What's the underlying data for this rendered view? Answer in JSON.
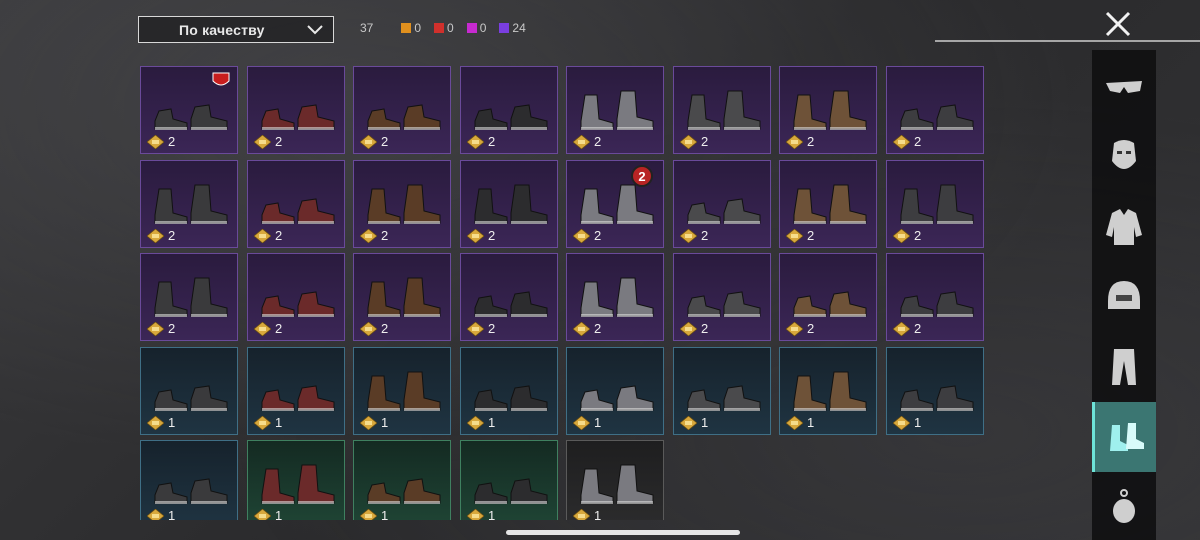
{
  "sort": {
    "label": "По качеству",
    "icon": "chevron-down-icon"
  },
  "counts": {
    "total": "37",
    "qualities": [
      {
        "color": "#e0901e",
        "value": "0"
      },
      {
        "color": "#d0302c",
        "value": "0"
      },
      {
        "color": "#c72ad1",
        "value": "0"
      },
      {
        "color": "#7a3ee0",
        "value": "24"
      }
    ]
  },
  "close_icon": "close-icon",
  "items": [
    {
      "quality": "purple",
      "count": "2",
      "icon": "sneakers-icon",
      "badge": "brand-badge"
    },
    {
      "quality": "purple",
      "count": "2",
      "icon": "sneakers-icon"
    },
    {
      "quality": "purple",
      "count": "2",
      "icon": "sneakers-icon"
    },
    {
      "quality": "purple",
      "count": "2",
      "icon": "sneakers-icon"
    },
    {
      "quality": "purple",
      "count": "2",
      "icon": "boots-icon"
    },
    {
      "quality": "purple",
      "count": "2",
      "icon": "boots-icon"
    },
    {
      "quality": "purple",
      "count": "2",
      "icon": "boots-icon"
    },
    {
      "quality": "purple",
      "count": "2",
      "icon": "sneakers-icon"
    },
    {
      "quality": "purple",
      "count": "2",
      "icon": "boots-icon"
    },
    {
      "quality": "purple",
      "count": "2",
      "icon": "shoes-icon"
    },
    {
      "quality": "purple",
      "count": "2",
      "icon": "boots-icon"
    },
    {
      "quality": "purple",
      "count": "2",
      "icon": "boots-icon"
    },
    {
      "quality": "purple",
      "count": "2",
      "icon": "boots-icon",
      "number_badge": "2"
    },
    {
      "quality": "purple",
      "count": "2",
      "icon": "sandals-icon"
    },
    {
      "quality": "purple",
      "count": "2",
      "icon": "boots-icon"
    },
    {
      "quality": "purple",
      "count": "2",
      "icon": "boots-icon"
    },
    {
      "quality": "purple",
      "count": "2",
      "icon": "boots-icon"
    },
    {
      "quality": "purple",
      "count": "2",
      "icon": "sneakers-icon"
    },
    {
      "quality": "purple",
      "count": "2",
      "icon": "boots-icon"
    },
    {
      "quality": "purple",
      "count": "2",
      "icon": "sneakers-icon"
    },
    {
      "quality": "purple",
      "count": "2",
      "icon": "boots-icon"
    },
    {
      "quality": "purple",
      "count": "2",
      "icon": "sneakers-icon"
    },
    {
      "quality": "purple",
      "count": "2",
      "icon": "sandals-icon"
    },
    {
      "quality": "purple",
      "count": "2",
      "icon": "shoes-icon"
    },
    {
      "quality": "blue",
      "count": "1",
      "icon": "sneakers-icon"
    },
    {
      "quality": "blue",
      "count": "1",
      "icon": "shoes-icon"
    },
    {
      "quality": "blue",
      "count": "1",
      "icon": "boots-icon"
    },
    {
      "quality": "blue",
      "count": "1",
      "icon": "sneakers-icon"
    },
    {
      "quality": "blue",
      "count": "1",
      "icon": "shoes-icon"
    },
    {
      "quality": "blue",
      "count": "1",
      "icon": "shoes-icon"
    },
    {
      "quality": "blue",
      "count": "1",
      "icon": "boots-icon"
    },
    {
      "quality": "blue",
      "count": "1",
      "icon": "shoes-icon"
    },
    {
      "quality": "blue",
      "count": "1",
      "icon": "shoes-icon"
    },
    {
      "quality": "green",
      "count": "1",
      "icon": "boots-icon"
    },
    {
      "quality": "green",
      "count": "1",
      "icon": "sneakers-icon"
    },
    {
      "quality": "green",
      "count": "1",
      "icon": "shoes-icon"
    },
    {
      "quality": "gray",
      "count": "1",
      "icon": "boots-icon"
    }
  ],
  "categories": [
    {
      "name": "glasses",
      "icon": "glasses-icon",
      "active": false
    },
    {
      "name": "mask",
      "icon": "mask-icon",
      "active": false
    },
    {
      "name": "jacket",
      "icon": "jacket-icon",
      "active": false
    },
    {
      "name": "headgear",
      "icon": "helmet-icon",
      "active": false
    },
    {
      "name": "pants",
      "icon": "pants-icon",
      "active": false
    },
    {
      "name": "shoes",
      "icon": "shoes-icon",
      "active": true
    },
    {
      "name": "pendant",
      "icon": "pendant-icon",
      "active": false
    }
  ]
}
